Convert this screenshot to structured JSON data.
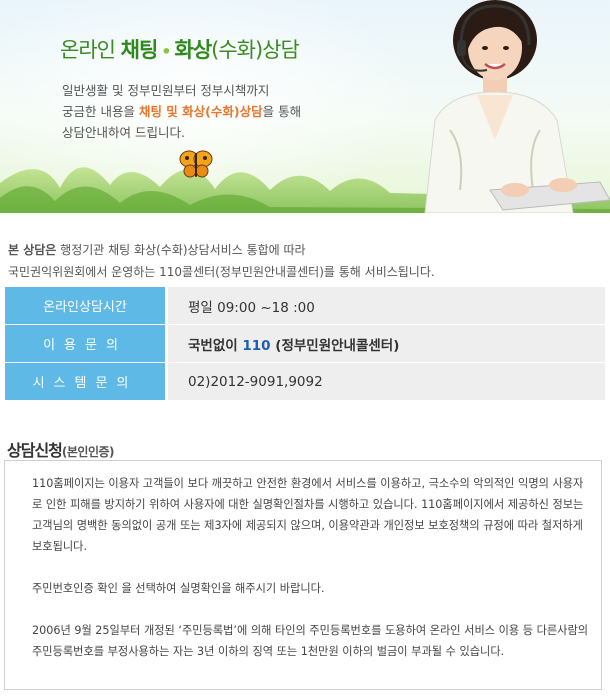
{
  "banner": {
    "title_part1": "온라인 ",
    "title_part2": "채팅",
    "title_dot": "•",
    "title_part3": "화상",
    "title_part4": "(수화)상담",
    "desc_line1": "일반생활 및 정부민원부터 정부시책까지",
    "desc_line2_pre": "궁금한 내용을 ",
    "desc_line2_hl": "채팅 및 화상(수화)상담",
    "desc_line2_post": "을 통해",
    "desc_line3": "상담안내하여 드립니다."
  },
  "intro": {
    "line1_bold": "본 상담은",
    "line1_rest": " 행정기관 채팅 화상(수화)상담서비스 통합에 따라",
    "line2": "국민권익위원회에서 운영하는 110콜센터(정부민원안내콜센터)를 통해 서비스됩니다."
  },
  "info_table": {
    "rows": [
      {
        "label": "온라인상담시간",
        "value": "평일 09:00 ~18 :00"
      },
      {
        "label": "이용문의",
        "value_pre": "국번없이 ",
        "value_num": "110",
        "value_post": " (정부민원안내콜센터)"
      },
      {
        "label": "시스템문의",
        "value": "02)2012-9091,9092"
      }
    ]
  },
  "section": {
    "title": "상담신청",
    "title_sub": "(본인인증)"
  },
  "notice": {
    "p1": "110홈페이지는 이용자 고객들이 보다 깨끗하고 안전한 환경에서 서비스를 이용하고, 극소수의 악의적인 익명의 사용자로 인한 피해를 방지하기 위하여 사용자에 대한 실명확인절차를 시행하고 있습니다. 110홈페이지에서 제공하신 정보는 고객님의 명백한 동의없이 공개 또는 제3자에 제공되지 않으며, 이용약관과 개인정보 보호정책의 규정에 따라 철저하게 보호됩니다.",
    "p2": "주민번호인증 확인 을 선택하여 실명확인을 해주시기 바랍니다.",
    "p3": "2006년 9월 25일부터 개정된 ‘주민등록법’에 의해 타인의 주민등록번호를 도용하여 온라인 서비스 이용 등 다른사람의 주민등록번호를 부정사용하는 자는 3년 이하의 징역 또는 1천만원 이하의 벌금이 부과될 수 있습니다."
  },
  "colors": {
    "accent_blue": "#5fb9e6",
    "highlight_orange": "#e8762c",
    "title_green": "#3a8c22"
  },
  "icons": {
    "butterfly": "butterfly-icon",
    "agent": "call-center-agent-illustration"
  }
}
